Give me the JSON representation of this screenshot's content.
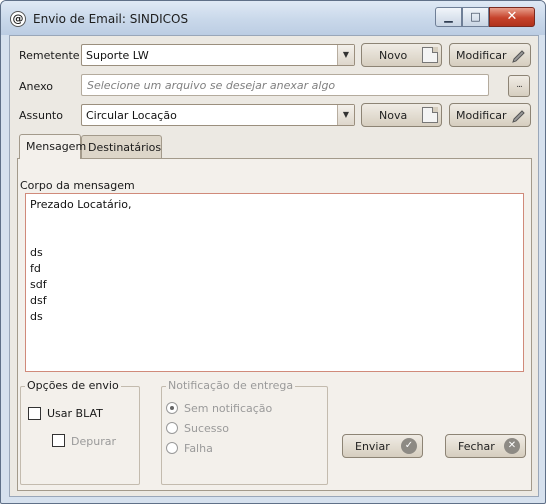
{
  "window": {
    "title": "Envio de Email: SINDICOS",
    "controls": {
      "minimize": "▁",
      "maximize": "□",
      "close": "✕"
    }
  },
  "form": {
    "remetente": {
      "label": "Remetente",
      "value": "Suporte LW",
      "new_button": "Novo",
      "edit_button": "Modificar"
    },
    "anexo": {
      "label": "Anexo",
      "placeholder": "Selecione um arquivo se desejar anexar algo",
      "browse_button": "..."
    },
    "assunto": {
      "label": "Assunto",
      "value": "Circular Locação",
      "new_button": "Nova",
      "edit_button": "Modificar"
    }
  },
  "tabs": [
    {
      "label": "Mensagem",
      "active": true
    },
    {
      "label": "Destinatários",
      "active": false
    }
  ],
  "message": {
    "body_label": "Corpo da mensagem",
    "lines": [
      "Prezado Locatário,",
      "",
      "",
      "ds",
      "fd",
      "sdf",
      "dsf",
      "ds"
    ]
  },
  "send_options": {
    "label": "Opções de envio",
    "usar_blat": {
      "label": "Usar BLAT",
      "checked": false
    },
    "depurar": {
      "label": "Depurar",
      "checked": false,
      "enabled": false
    }
  },
  "delivery_notification": {
    "label": "Notificação de entrega",
    "enabled": false,
    "options": [
      {
        "label": "Sem notificação",
        "selected": true
      },
      {
        "label": "Sucesso",
        "selected": false
      },
      {
        "label": "Falha",
        "selected": false
      }
    ]
  },
  "actions": {
    "send": "Enviar",
    "close": "Fechar"
  },
  "icons": {
    "new": "document-icon",
    "edit": "pencil-icon",
    "send": "check-circle-icon",
    "close": "x-circle-icon",
    "app": "at-sign-icon"
  }
}
